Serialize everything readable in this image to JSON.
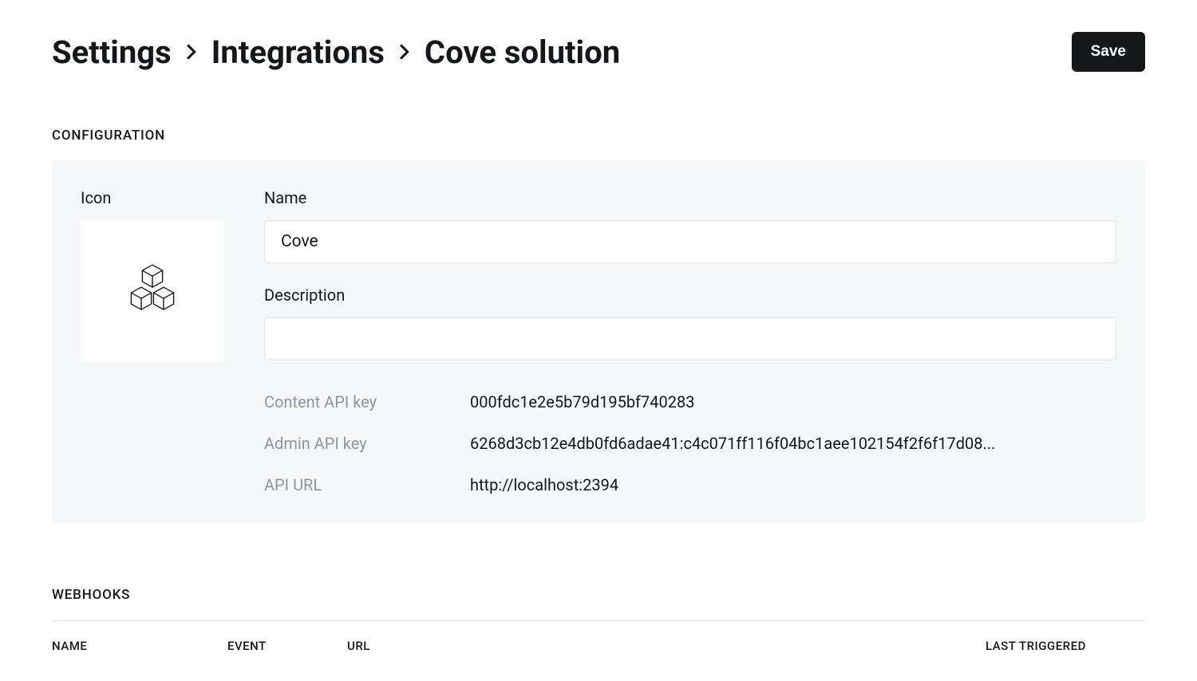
{
  "header": {
    "breadcrumb": [
      "Settings",
      "Integrations",
      "Cove solution"
    ],
    "save_label": "Save"
  },
  "configuration": {
    "section_label": "CONFIGURATION",
    "icon_label": "Icon",
    "name_label": "Name",
    "name_value": "Cove",
    "description_label": "Description",
    "description_value": "",
    "api_keys": {
      "content_label": "Content API key",
      "content_value": "000fdc1e2e5b79d195bf740283",
      "admin_label": "Admin API key",
      "admin_value": "6268d3cb12e4db0fd6adae41:c4c071ff116f04bc1aee102154f2f6f17d08...",
      "url_label": "API URL",
      "url_value": "http://localhost:2394"
    }
  },
  "webhooks": {
    "section_label": "WEBHOOKS",
    "columns": {
      "name": "NAME",
      "event": "EVENT",
      "url": "URL",
      "last_triggered": "LAST TRIGGERED"
    }
  }
}
